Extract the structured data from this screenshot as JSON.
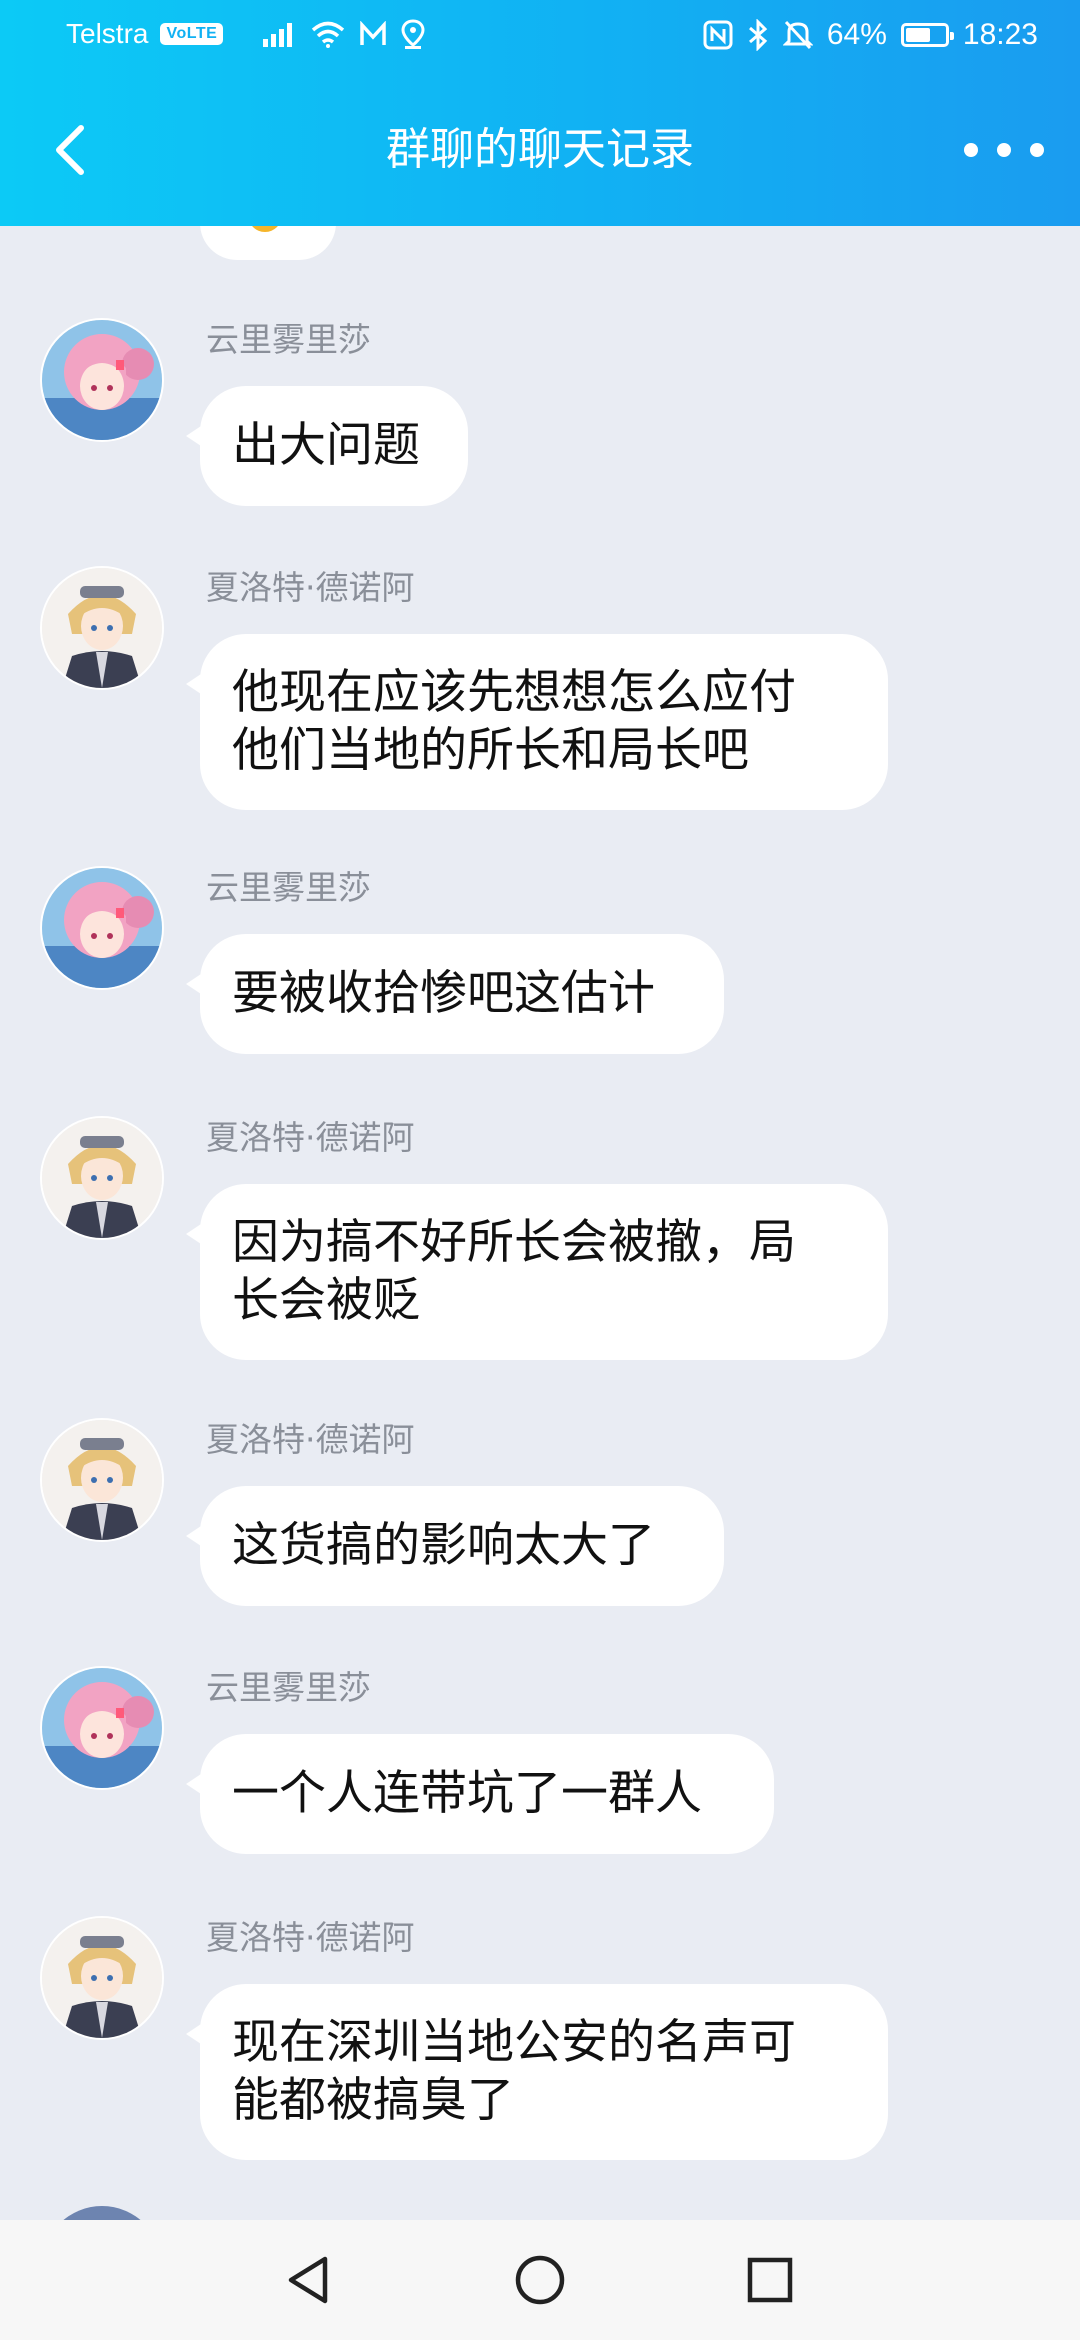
{
  "status_bar": {
    "carrier": "Telstra",
    "volte": "VoLTE",
    "battery_percent": "64%",
    "battery_level": 0.64,
    "time": "18:23",
    "icons": [
      "signal-icon",
      "wifi-icon",
      "mail-icon",
      "location-icon",
      "nfc-icon",
      "bluetooth-icon",
      "mute-icon",
      "battery-icon"
    ]
  },
  "header": {
    "title": "群聊的聊天记录",
    "back_icon": "back-chevron-icon",
    "more_icon": "more-dots-icon"
  },
  "messages": [
    {
      "sender": "云里雾里莎",
      "lines": [
        "出大问题"
      ]
    },
    {
      "sender": "夏洛特·德诺阿",
      "lines": [
        "他现在应该先想想怎么应付",
        "他们当地的所长和局长吧"
      ]
    },
    {
      "sender": "云里雾里莎",
      "lines": [
        "要被收拾惨吧这估计"
      ]
    },
    {
      "sender": "夏洛特·德诺阿",
      "lines": [
        "因为搞不好所长会被撤，局",
        "长会被贬"
      ]
    },
    {
      "sender": "夏洛特·德诺阿",
      "lines": [
        "这货搞的影响太大了"
      ]
    },
    {
      "sender": "云里雾里莎",
      "lines": [
        "一个人连带坑了一群人"
      ]
    },
    {
      "sender": "夏洛特·德诺阿",
      "lines": [
        "现在深圳当地公安的名声可",
        "能都被搞臭了"
      ]
    }
  ],
  "colors": {
    "header_gradient_start": "#0ccaf6",
    "header_gradient_end": "#1a9cf0",
    "background": "#e9ecf3",
    "bubble": "#ffffff",
    "sender_name": "#8a8f99"
  },
  "nav": {
    "back_icon": "triangle-back-icon",
    "home_icon": "circle-home-icon",
    "recents_icon": "square-recents-icon"
  }
}
